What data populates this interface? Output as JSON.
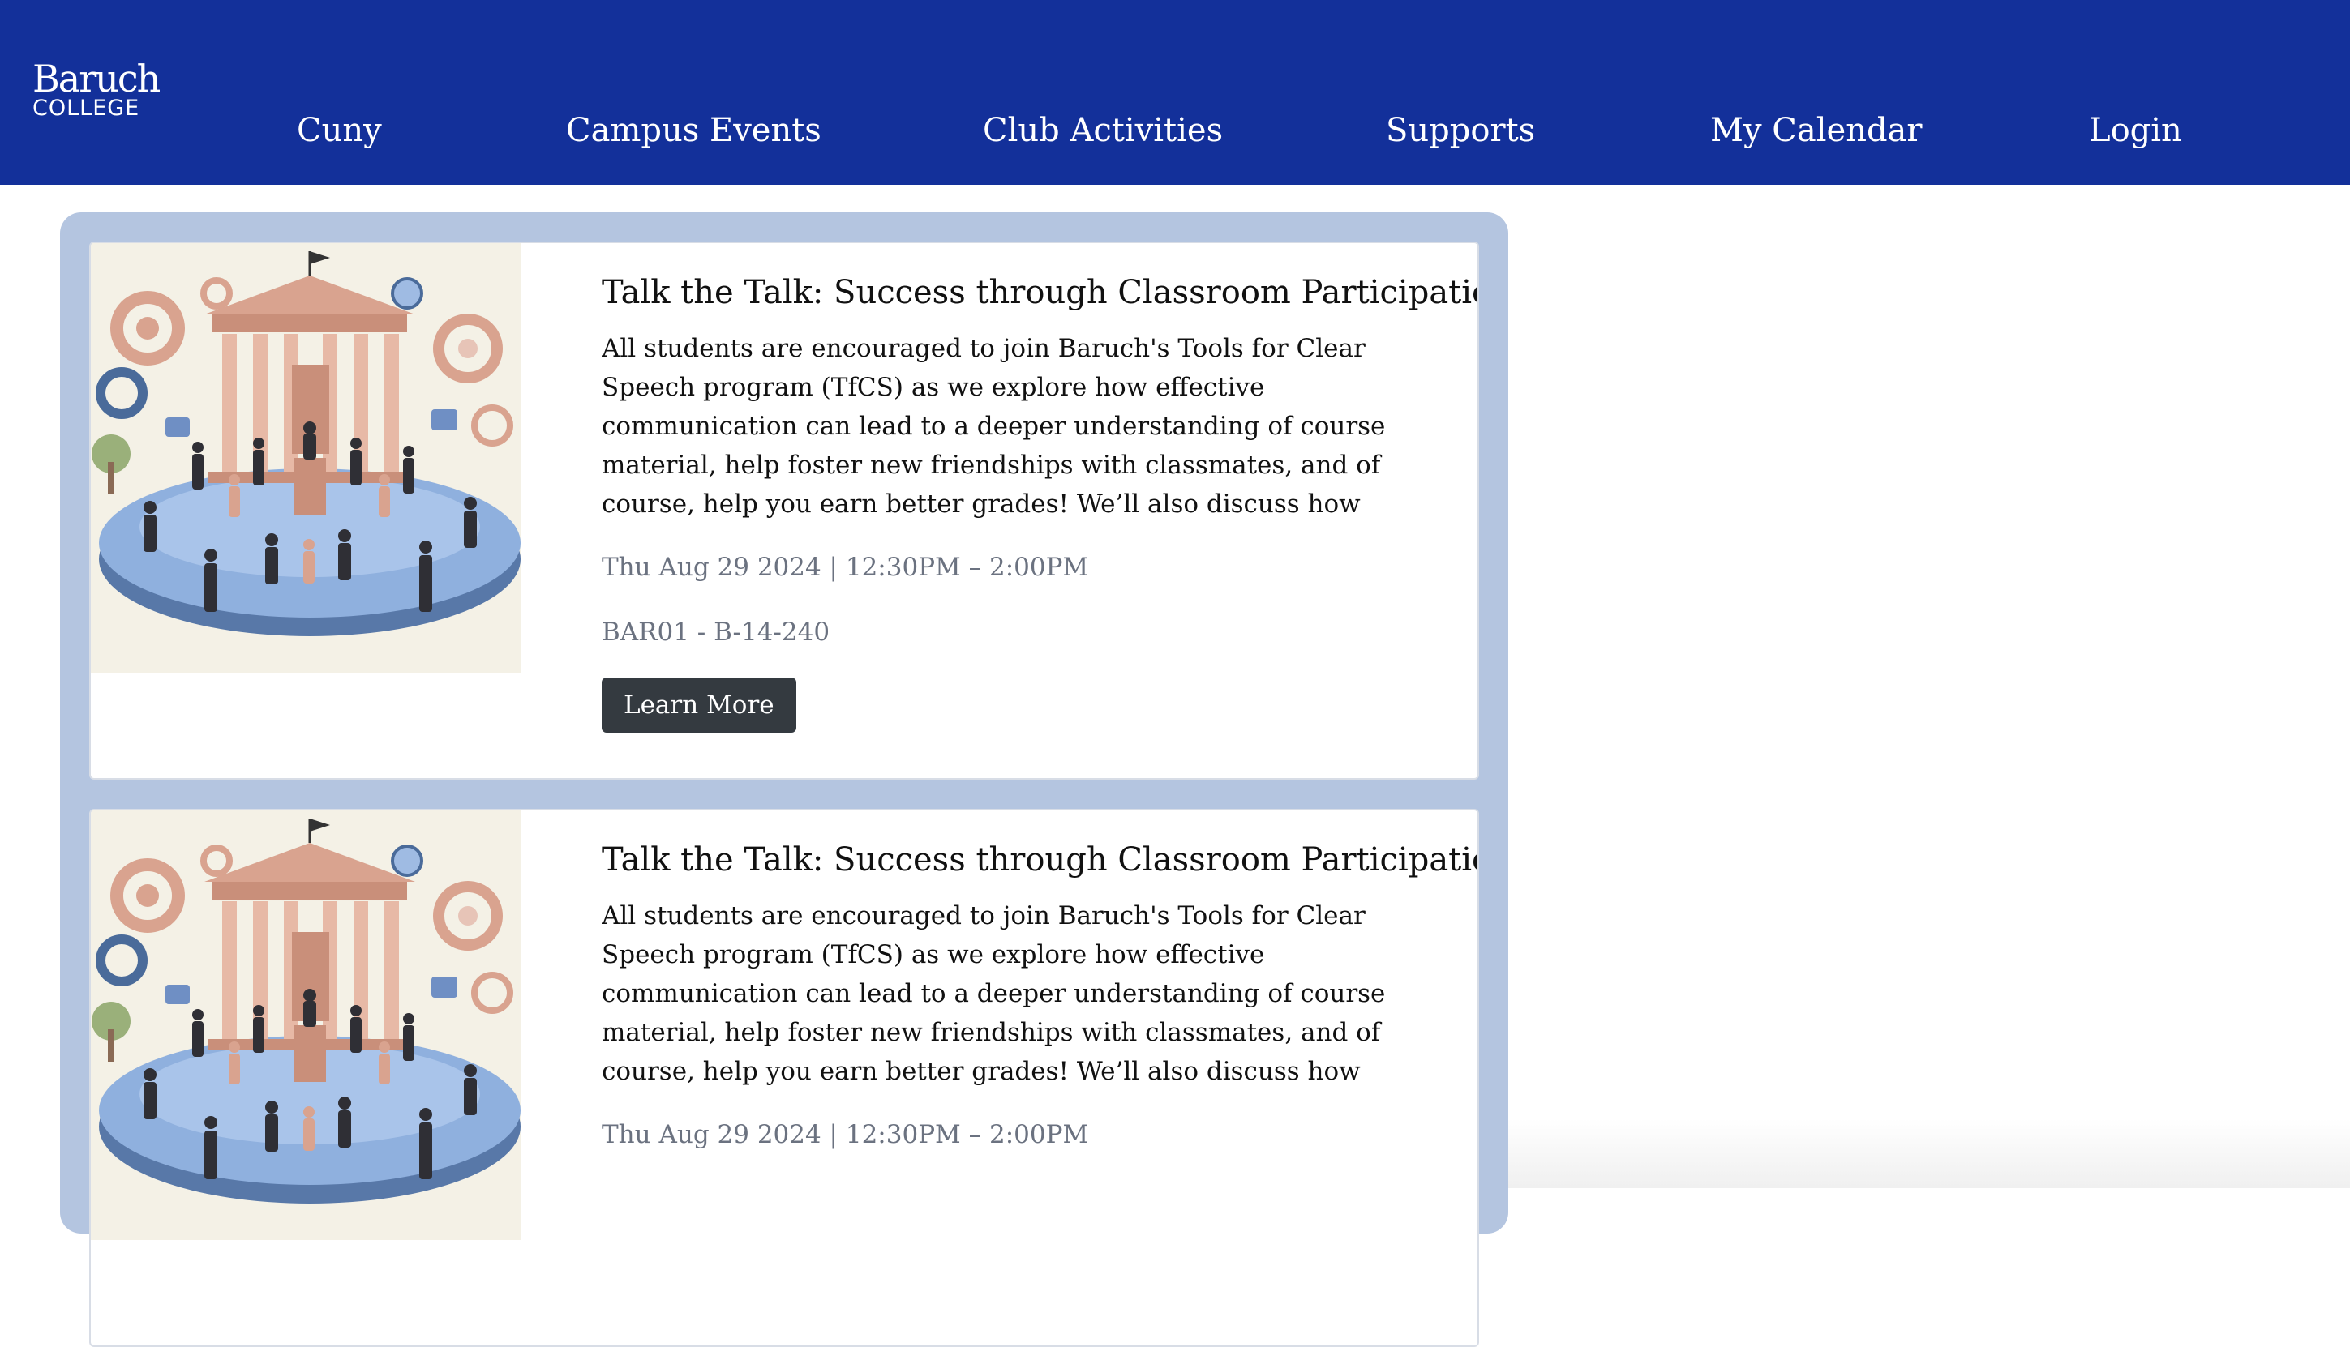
{
  "brand": {
    "logo_top": "Baruch",
    "logo_bottom": "COLLEGE",
    "header_color": "#13309a"
  },
  "nav": {
    "items": [
      {
        "label": "Cuny"
      },
      {
        "label": "Campus Events"
      },
      {
        "label": "Club Activities"
      },
      {
        "label": "Supports"
      },
      {
        "label": "My Calendar"
      },
      {
        "label": "Login"
      }
    ]
  },
  "events": [
    {
      "image_icon": "classroom-participation-illustration",
      "title": "Talk the Talk: Success through Classroom Participation",
      "description": "All students are encouraged to join Baruch's Tools for Clear Speech program (TfCS) as we explore how effective communication can lead to a deeper understanding of course material, help foster new friendships with classmates, and of course, help you earn better grades! We’ll also discuss how strategic group communication skills can enhance career…",
      "datetime": "Thu Aug 29 2024 | 12:30PM – 2:00PM",
      "location": "BAR01 - B-14-240",
      "button_label": "Learn More"
    },
    {
      "image_icon": "classroom-participation-illustration",
      "title": "Talk the Talk: Success through Classroom Participation",
      "description": "All students are encouraged to join Baruch's Tools for Clear Speech program (TfCS) as we explore how effective communication can lead to a deeper understanding of course material, help foster new friendships with classmates, and of course, help you earn better grades! We’ll also discuss how strategic group communication skills can enhance career…",
      "datetime": "Thu Aug 29 2024 | 12:30PM – 2:00PM"
    }
  ],
  "colors": {
    "panel": "#b4c5e0",
    "button": "#343a40",
    "meta_text": "#6b7280"
  }
}
